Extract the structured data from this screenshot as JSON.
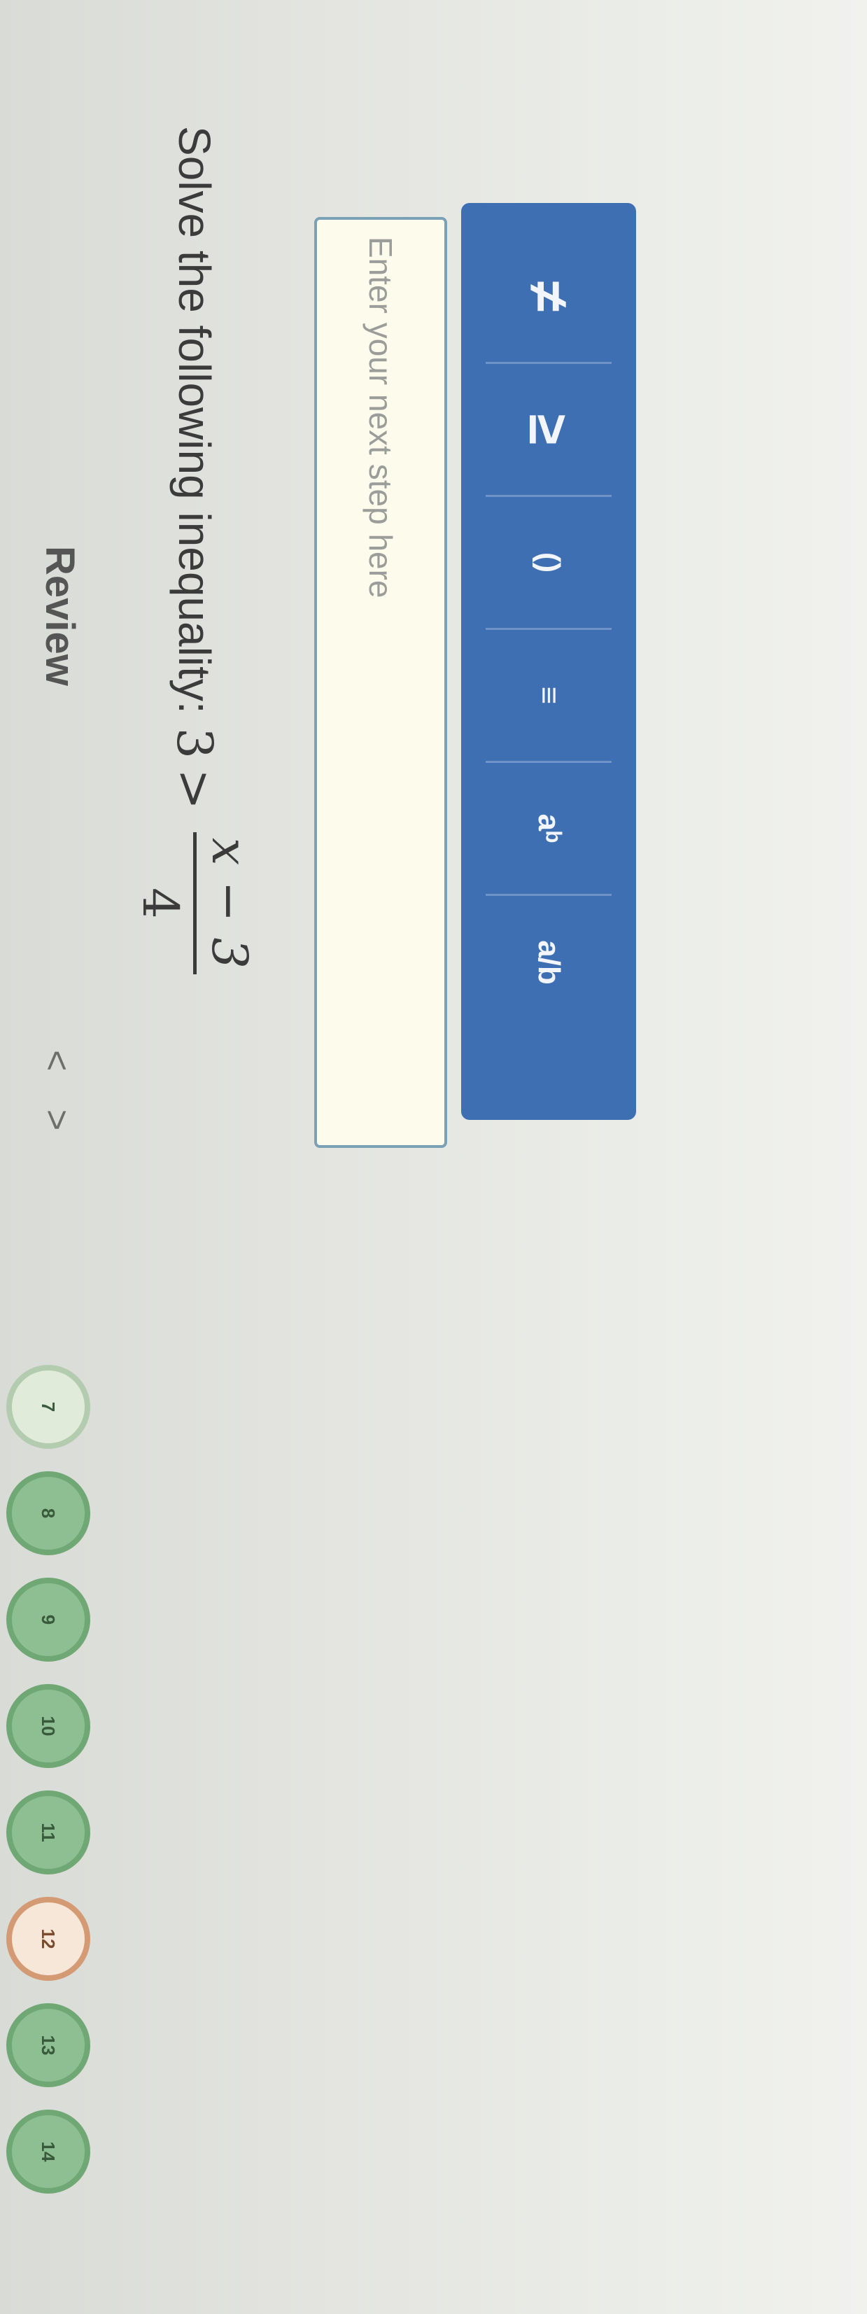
{
  "header": {
    "title": "Review"
  },
  "nav": {
    "prev": "<",
    "next": ">"
  },
  "questions": {
    "items": [
      {
        "label": "7",
        "state": "current"
      },
      {
        "label": "8",
        "state": "done"
      },
      {
        "label": "9",
        "state": "done"
      },
      {
        "label": "10",
        "state": "done"
      },
      {
        "label": "11",
        "state": "done"
      },
      {
        "label": "12",
        "state": "flagged"
      },
      {
        "label": "13",
        "state": "done"
      },
      {
        "label": "14",
        "state": "done"
      }
    ]
  },
  "question": {
    "prompt": "Solve the following inequality:",
    "lhs": "3",
    "operator": ">",
    "numerator": "x − 3",
    "denominator": "4"
  },
  "answer": {
    "placeholder": "Enter your next step here"
  },
  "toolbar": {
    "buttons": [
      {
        "label": "≠",
        "icon": "not-equal-icon"
      },
      {
        "label": "≥",
        "icon": "greater-equal-icon"
      },
      {
        "label": "()",
        "icon": "parentheses-icon"
      },
      {
        "label": "≡",
        "icon": "matrix-icon"
      },
      {
        "label": "aᵇ",
        "icon": "exponent-icon"
      },
      {
        "label": "a/b",
        "icon": "fraction-icon"
      }
    ]
  },
  "colors": {
    "toolbar": "#3f6fb3",
    "input_border": "#7ba1b6",
    "done": "#8ebf93",
    "flagged": "#d49a74"
  }
}
